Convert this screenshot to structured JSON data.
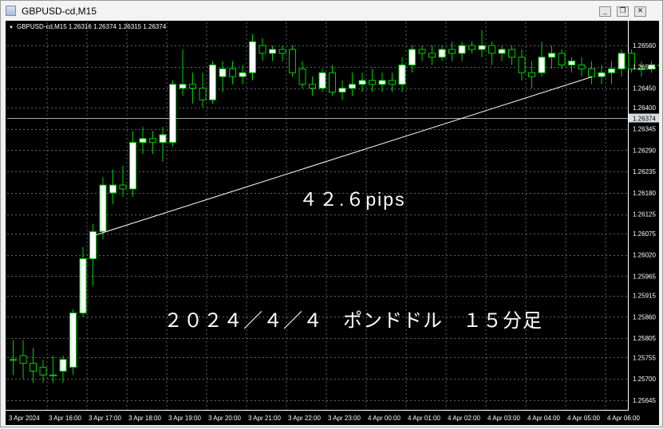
{
  "window": {
    "title": "GBPUSD-cd,M15",
    "minimize_glyph": "_",
    "restore_glyph": "❐",
    "close_glyph": "✕"
  },
  "chart_info": {
    "marker": "▼",
    "symbol_line": "GBPUSD-cd,M15  1.26316 1.26374 1.26315 1.26374"
  },
  "annotations": {
    "pips_label": "４２.６pips",
    "caption": "２０２４／４／４　ポンドドル　１５分足"
  },
  "colors": {
    "background": "#000000",
    "grid": "#5a6472",
    "bull_body": "#ffffff",
    "bear_body": "#000000",
    "candle_line": "#00cc00",
    "axis_text": "#ffffff",
    "price_line": "#a0a8b0",
    "trend_line": "#ffffff"
  },
  "chart_data": {
    "type": "candlestick",
    "title": "GBPUSD-cd,M15",
    "symbol": "GBPUSD-cd",
    "timeframe": "M15",
    "current_bar": {
      "open": 1.26316,
      "high": 1.26374,
      "low": 1.26315,
      "close": 1.26374
    },
    "current_price_label": "1.26374",
    "current_price": 1.26374,
    "ylim": [
      1.26622,
      1.26594
    ],
    "y_range": [
      1.2562,
      1.2662
    ],
    "y_ticks": [
      "1.26560",
      "1.26505",
      "1.26450",
      "1.26400",
      "1.26345",
      "1.26290",
      "1.26235",
      "1.26180",
      "1.26125",
      "1.26075",
      "1.26020",
      "1.25965",
      "1.25915",
      "1.25860",
      "1.25805",
      "1.25755",
      "1.25700",
      "1.25645"
    ],
    "y_tick_values": [
      1.2656,
      1.26505,
      1.2645,
      1.264,
      1.26345,
      1.2629,
      1.26235,
      1.2618,
      1.26125,
      1.26075,
      1.2602,
      1.25965,
      1.25915,
      1.2586,
      1.25805,
      1.25755,
      1.257,
      1.25645
    ],
    "x_ticks": [
      "3 Apr 2024",
      "3 Apr 16:00",
      "3 Apr 17:00",
      "3 Apr 18:00",
      "3 Apr 19:00",
      "3 Apr 20:00",
      "3 Apr 21:00",
      "3 Apr 22:00",
      "3 Apr 23:00",
      "4 Apr 00:00",
      "4 Apr 01:00",
      "4 Apr 02:00",
      "4 Apr 03:00",
      "4 Apr 04:00",
      "4 Apr 05:00",
      "4 Apr 06:00"
    ],
    "candles": [
      {
        "o": 1.2575,
        "h": 1.258,
        "l": 1.2571,
        "c": 1.2575
      },
      {
        "o": 1.2576,
        "h": 1.258,
        "l": 1.257,
        "c": 1.2574
      },
      {
        "o": 1.2574,
        "h": 1.2578,
        "l": 1.2569,
        "c": 1.2572
      },
      {
        "o": 1.2573,
        "h": 1.2575,
        "l": 1.2569,
        "c": 1.2571
      },
      {
        "o": 1.2571,
        "h": 1.2576,
        "l": 1.2569,
        "c": 1.2571
      },
      {
        "o": 1.2572,
        "h": 1.2576,
        "l": 1.2569,
        "c": 1.2575
      },
      {
        "o": 1.2573,
        "h": 1.2588,
        "l": 1.2571,
        "c": 1.2587
      },
      {
        "o": 1.2587,
        "h": 1.2604,
        "l": 1.2586,
        "c": 1.2601
      },
      {
        "o": 1.2601,
        "h": 1.261,
        "l": 1.2594,
        "c": 1.2608
      },
      {
        "o": 1.2608,
        "h": 1.2622,
        "l": 1.2606,
        "c": 1.262
      },
      {
        "o": 1.2618,
        "h": 1.2624,
        "l": 1.2615,
        "c": 1.262
      },
      {
        "o": 1.262,
        "h": 1.2625,
        "l": 1.2617,
        "c": 1.2619
      },
      {
        "o": 1.2619,
        "h": 1.2634,
        "l": 1.2617,
        "c": 1.2631
      },
      {
        "o": 1.2631,
        "h": 1.2635,
        "l": 1.2628,
        "c": 1.2632
      },
      {
        "o": 1.2632,
        "h": 1.2634,
        "l": 1.2628,
        "c": 1.2631
      },
      {
        "o": 1.2631,
        "h": 1.2635,
        "l": 1.2626,
        "c": 1.2633
      },
      {
        "o": 1.2631,
        "h": 1.2647,
        "l": 1.263,
        "c": 1.2646
      },
      {
        "o": 1.2645,
        "h": 1.2655,
        "l": 1.2643,
        "c": 1.2646
      },
      {
        "o": 1.2646,
        "h": 1.2649,
        "l": 1.2641,
        "c": 1.2645
      },
      {
        "o": 1.2645,
        "h": 1.2649,
        "l": 1.264,
        "c": 1.2642
      },
      {
        "o": 1.2642,
        "h": 1.2652,
        "l": 1.2641,
        "c": 1.2651
      },
      {
        "o": 1.2648,
        "h": 1.2652,
        "l": 1.2644,
        "c": 1.265
      },
      {
        "o": 1.265,
        "h": 1.2652,
        "l": 1.2646,
        "c": 1.2648
      },
      {
        "o": 1.2648,
        "h": 1.2651,
        "l": 1.2646,
        "c": 1.2649
      },
      {
        "o": 1.2649,
        "h": 1.2659,
        "l": 1.2647,
        "c": 1.2657
      },
      {
        "o": 1.2656,
        "h": 1.2658,
        "l": 1.2652,
        "c": 1.2654
      },
      {
        "o": 1.2654,
        "h": 1.2656,
        "l": 1.2652,
        "c": 1.2655
      },
      {
        "o": 1.2655,
        "h": 1.2656,
        "l": 1.2652,
        "c": 1.2654
      },
      {
        "o": 1.2655,
        "h": 1.2656,
        "l": 1.2648,
        "c": 1.2649
      },
      {
        "o": 1.265,
        "h": 1.2652,
        "l": 1.2645,
        "c": 1.2646
      },
      {
        "o": 1.2646,
        "h": 1.2648,
        "l": 1.2643,
        "c": 1.2645
      },
      {
        "o": 1.2645,
        "h": 1.265,
        "l": 1.2644,
        "c": 1.2649
      },
      {
        "o": 1.2649,
        "h": 1.2651,
        "l": 1.2643,
        "c": 1.2644
      },
      {
        "o": 1.2644,
        "h": 1.2647,
        "l": 1.2642,
        "c": 1.2645
      },
      {
        "o": 1.2645,
        "h": 1.2649,
        "l": 1.2643,
        "c": 1.2646
      },
      {
        "o": 1.2646,
        "h": 1.2649,
        "l": 1.2644,
        "c": 1.2647
      },
      {
        "o": 1.2647,
        "h": 1.265,
        "l": 1.2644,
        "c": 1.2646
      },
      {
        "o": 1.2646,
        "h": 1.2649,
        "l": 1.2644,
        "c": 1.2647
      },
      {
        "o": 1.2647,
        "h": 1.2649,
        "l": 1.2644,
        "c": 1.2646
      },
      {
        "o": 1.2646,
        "h": 1.2653,
        "l": 1.2644,
        "c": 1.2651
      },
      {
        "o": 1.2651,
        "h": 1.2656,
        "l": 1.2649,
        "c": 1.2655
      },
      {
        "o": 1.2655,
        "h": 1.2656,
        "l": 1.2652,
        "c": 1.2654
      },
      {
        "o": 1.2654,
        "h": 1.2656,
        "l": 1.2651,
        "c": 1.2653
      },
      {
        "o": 1.2653,
        "h": 1.2656,
        "l": 1.2652,
        "c": 1.2655
      },
      {
        "o": 1.2655,
        "h": 1.2657,
        "l": 1.2652,
        "c": 1.2654
      },
      {
        "o": 1.2654,
        "h": 1.2657,
        "l": 1.2652,
        "c": 1.2656
      },
      {
        "o": 1.2656,
        "h": 1.2657,
        "l": 1.2654,
        "c": 1.2655
      },
      {
        "o": 1.2655,
        "h": 1.266,
        "l": 1.2653,
        "c": 1.2656
      },
      {
        "o": 1.2656,
        "h": 1.2657,
        "l": 1.2651,
        "c": 1.2654
      },
      {
        "o": 1.2654,
        "h": 1.2656,
        "l": 1.2652,
        "c": 1.2655
      },
      {
        "o": 1.2655,
        "h": 1.2656,
        "l": 1.2651,
        "c": 1.2653
      },
      {
        "o": 1.2653,
        "h": 1.2655,
        "l": 1.2647,
        "c": 1.2649
      },
      {
        "o": 1.2649,
        "h": 1.2652,
        "l": 1.2645,
        "c": 1.2648
      },
      {
        "o": 1.2649,
        "h": 1.2657,
        "l": 1.2648,
        "c": 1.2653
      },
      {
        "o": 1.2653,
        "h": 1.2656,
        "l": 1.265,
        "c": 1.2654
      },
      {
        "o": 1.2654,
        "h": 1.2655,
        "l": 1.265,
        "c": 1.2651
      },
      {
        "o": 1.2651,
        "h": 1.2653,
        "l": 1.2649,
        "c": 1.2652
      },
      {
        "o": 1.2651,
        "h": 1.2653,
        "l": 1.2648,
        "c": 1.265
      },
      {
        "o": 1.265,
        "h": 1.2652,
        "l": 1.2646,
        "c": 1.2648
      },
      {
        "o": 1.2648,
        "h": 1.2651,
        "l": 1.2646,
        "c": 1.2649
      },
      {
        "o": 1.2649,
        "h": 1.2652,
        "l": 1.2646,
        "c": 1.265
      },
      {
        "o": 1.265,
        "h": 1.2655,
        "l": 1.2648,
        "c": 1.2654
      },
      {
        "o": 1.2654,
        "h": 1.2655,
        "l": 1.2649,
        "c": 1.265
      },
      {
        "o": 1.265,
        "h": 1.2652,
        "l": 1.2648,
        "c": 1.265
      },
      {
        "o": 1.265,
        "h": 1.2652,
        "l": 1.2649,
        "c": 1.2651
      },
      {
        "o": 1.2651,
        "h": 1.2653,
        "l": 1.265,
        "c": 1.2651
      },
      {
        "o": 1.2651,
        "h": 1.2652,
        "l": 1.265,
        "c": 1.2652
      }
    ],
    "trend_line": {
      "from_candle": 8,
      "from_price": 1.26069,
      "to_candle": 58,
      "to_price": 1.26479
    },
    "grid": true
  }
}
